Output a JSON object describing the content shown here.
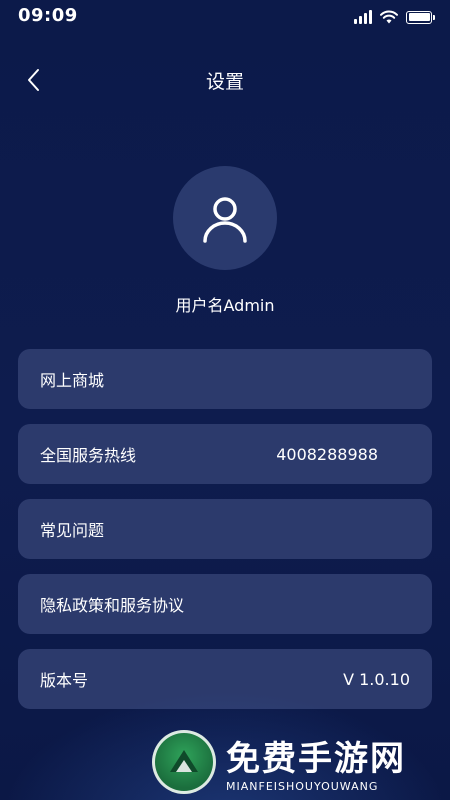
{
  "status_bar": {
    "time": "09:09"
  },
  "nav": {
    "title": "设置"
  },
  "profile": {
    "username": "用户名Admin"
  },
  "menu": {
    "items": [
      {
        "label": "网上商城",
        "value": ""
      },
      {
        "label": "全国服务热线",
        "value": "4008288988"
      },
      {
        "label": "常见问题",
        "value": ""
      },
      {
        "label": "隐私政策和服务协议",
        "value": ""
      },
      {
        "label": "版本号",
        "value": "V 1.0.10"
      }
    ]
  },
  "watermark": {
    "title": "免费手游网",
    "subtitle": "MIANFEISHOUYOUWANG"
  },
  "colors": {
    "background": "#0c1a4a",
    "card": "#2c3a6c",
    "avatar_bg": "#2a3a6e",
    "text": "#ffffff"
  },
  "icons": {
    "back": "chevron-left-icon",
    "avatar": "user-icon",
    "signal": "signal-icon",
    "wifi": "wifi-icon",
    "battery": "battery-icon"
  }
}
